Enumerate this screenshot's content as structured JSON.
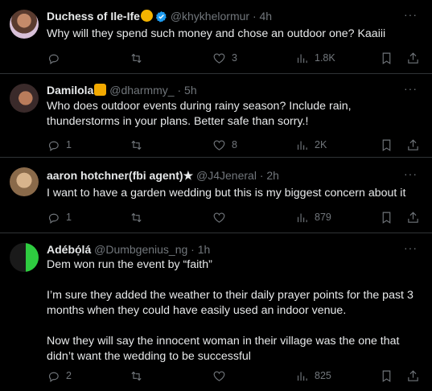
{
  "tweets": [
    {
      "name": "Duchess of Ile-Ife",
      "handle": "@khykhelormur",
      "time": "4h",
      "text": "Why will they spend such money and chose an outdoor one? Kaaiii",
      "replies": "",
      "retweets": "",
      "likes": "3",
      "views": "1.8K"
    },
    {
      "name": "Damilola",
      "handle": "@dharmmy_",
      "time": "5h",
      "text": "Who does outdoor events during rainy season? Include rain, thunderstorms in your plans. Better safe than sorry.!",
      "replies": "1",
      "retweets": "",
      "likes": "8",
      "views": "2K"
    },
    {
      "name": "aaron hotchner(fbi agent)",
      "handle": "@J4Jeneral",
      "time": "2h",
      "text": "I want to have a garden wedding but this is my biggest concern about it",
      "replies": "1",
      "retweets": "",
      "likes": "",
      "views": "879"
    },
    {
      "name": "Adébọ́lá",
      "handle": "@Dumbgenius_ng",
      "time": "1h",
      "text": "Dem won run the event by “faith”\n\nI’m sure they added the weather to their daily prayer points for the past 3 months when they could have easily used an indoor venue.\n\nNow they will say the innocent woman in their village was the one that didn’t want the wedding to be successful",
      "replies": "2",
      "retweets": "",
      "likes": "",
      "views": "825"
    }
  ],
  "colors": {
    "background": "#000000",
    "text": "#e7e9ea",
    "muted": "#71767b",
    "border": "#2f3336",
    "verified": "#1d9bf0"
  },
  "icons": {
    "reply": "reply-icon",
    "retweet": "retweet-icon",
    "like": "heart-icon",
    "views": "views-icon",
    "bookmark": "bookmark-icon",
    "share": "share-icon",
    "more": "more-icon"
  }
}
